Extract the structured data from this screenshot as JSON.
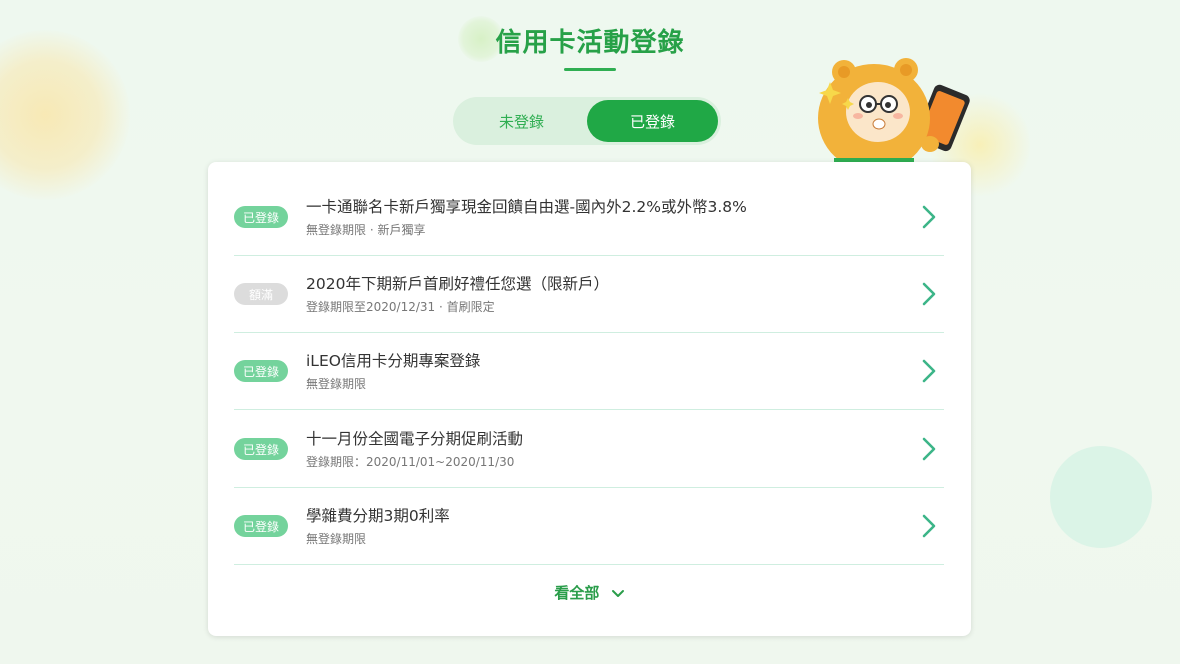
{
  "page": {
    "title": "信用卡活動登錄"
  },
  "tabs": [
    {
      "label": "未登錄",
      "active": false
    },
    {
      "label": "已登錄",
      "active": true
    }
  ],
  "items": [
    {
      "badge": "已登錄",
      "badge_type": "on",
      "title": "一卡通聯名卡新戶獨享現金回饋自由選-國內外2.2%或外幣3.8%",
      "subtitle": "無登錄期限 · 新戶獨享"
    },
    {
      "badge": "額滿",
      "badge_type": "full",
      "title": "2020年下期新戶首刷好禮任您選（限新戶）",
      "subtitle": "登錄期限至2020/12/31 · 首刷限定"
    },
    {
      "badge": "已登錄",
      "badge_type": "on",
      "title": "iLEO信用卡分期專案登錄",
      "subtitle": "無登錄期限"
    },
    {
      "badge": "已登錄",
      "badge_type": "on",
      "title": "十一月份全國電子分期促刷活動",
      "subtitle": "登錄期限：2020/11/01~2020/11/30"
    },
    {
      "badge": "已登錄",
      "badge_type": "on",
      "title": "學雜費分期3期0利率",
      "subtitle": "無登錄期限"
    }
  ],
  "see_all": {
    "label": "看全部",
    "icon": "chevron-down-icon"
  },
  "colors": {
    "primary": "#20a846",
    "title": "#27a148",
    "badge_on": "#74d39c",
    "badge_full": "#dcdcdc",
    "chevron": "#3cb588"
  }
}
